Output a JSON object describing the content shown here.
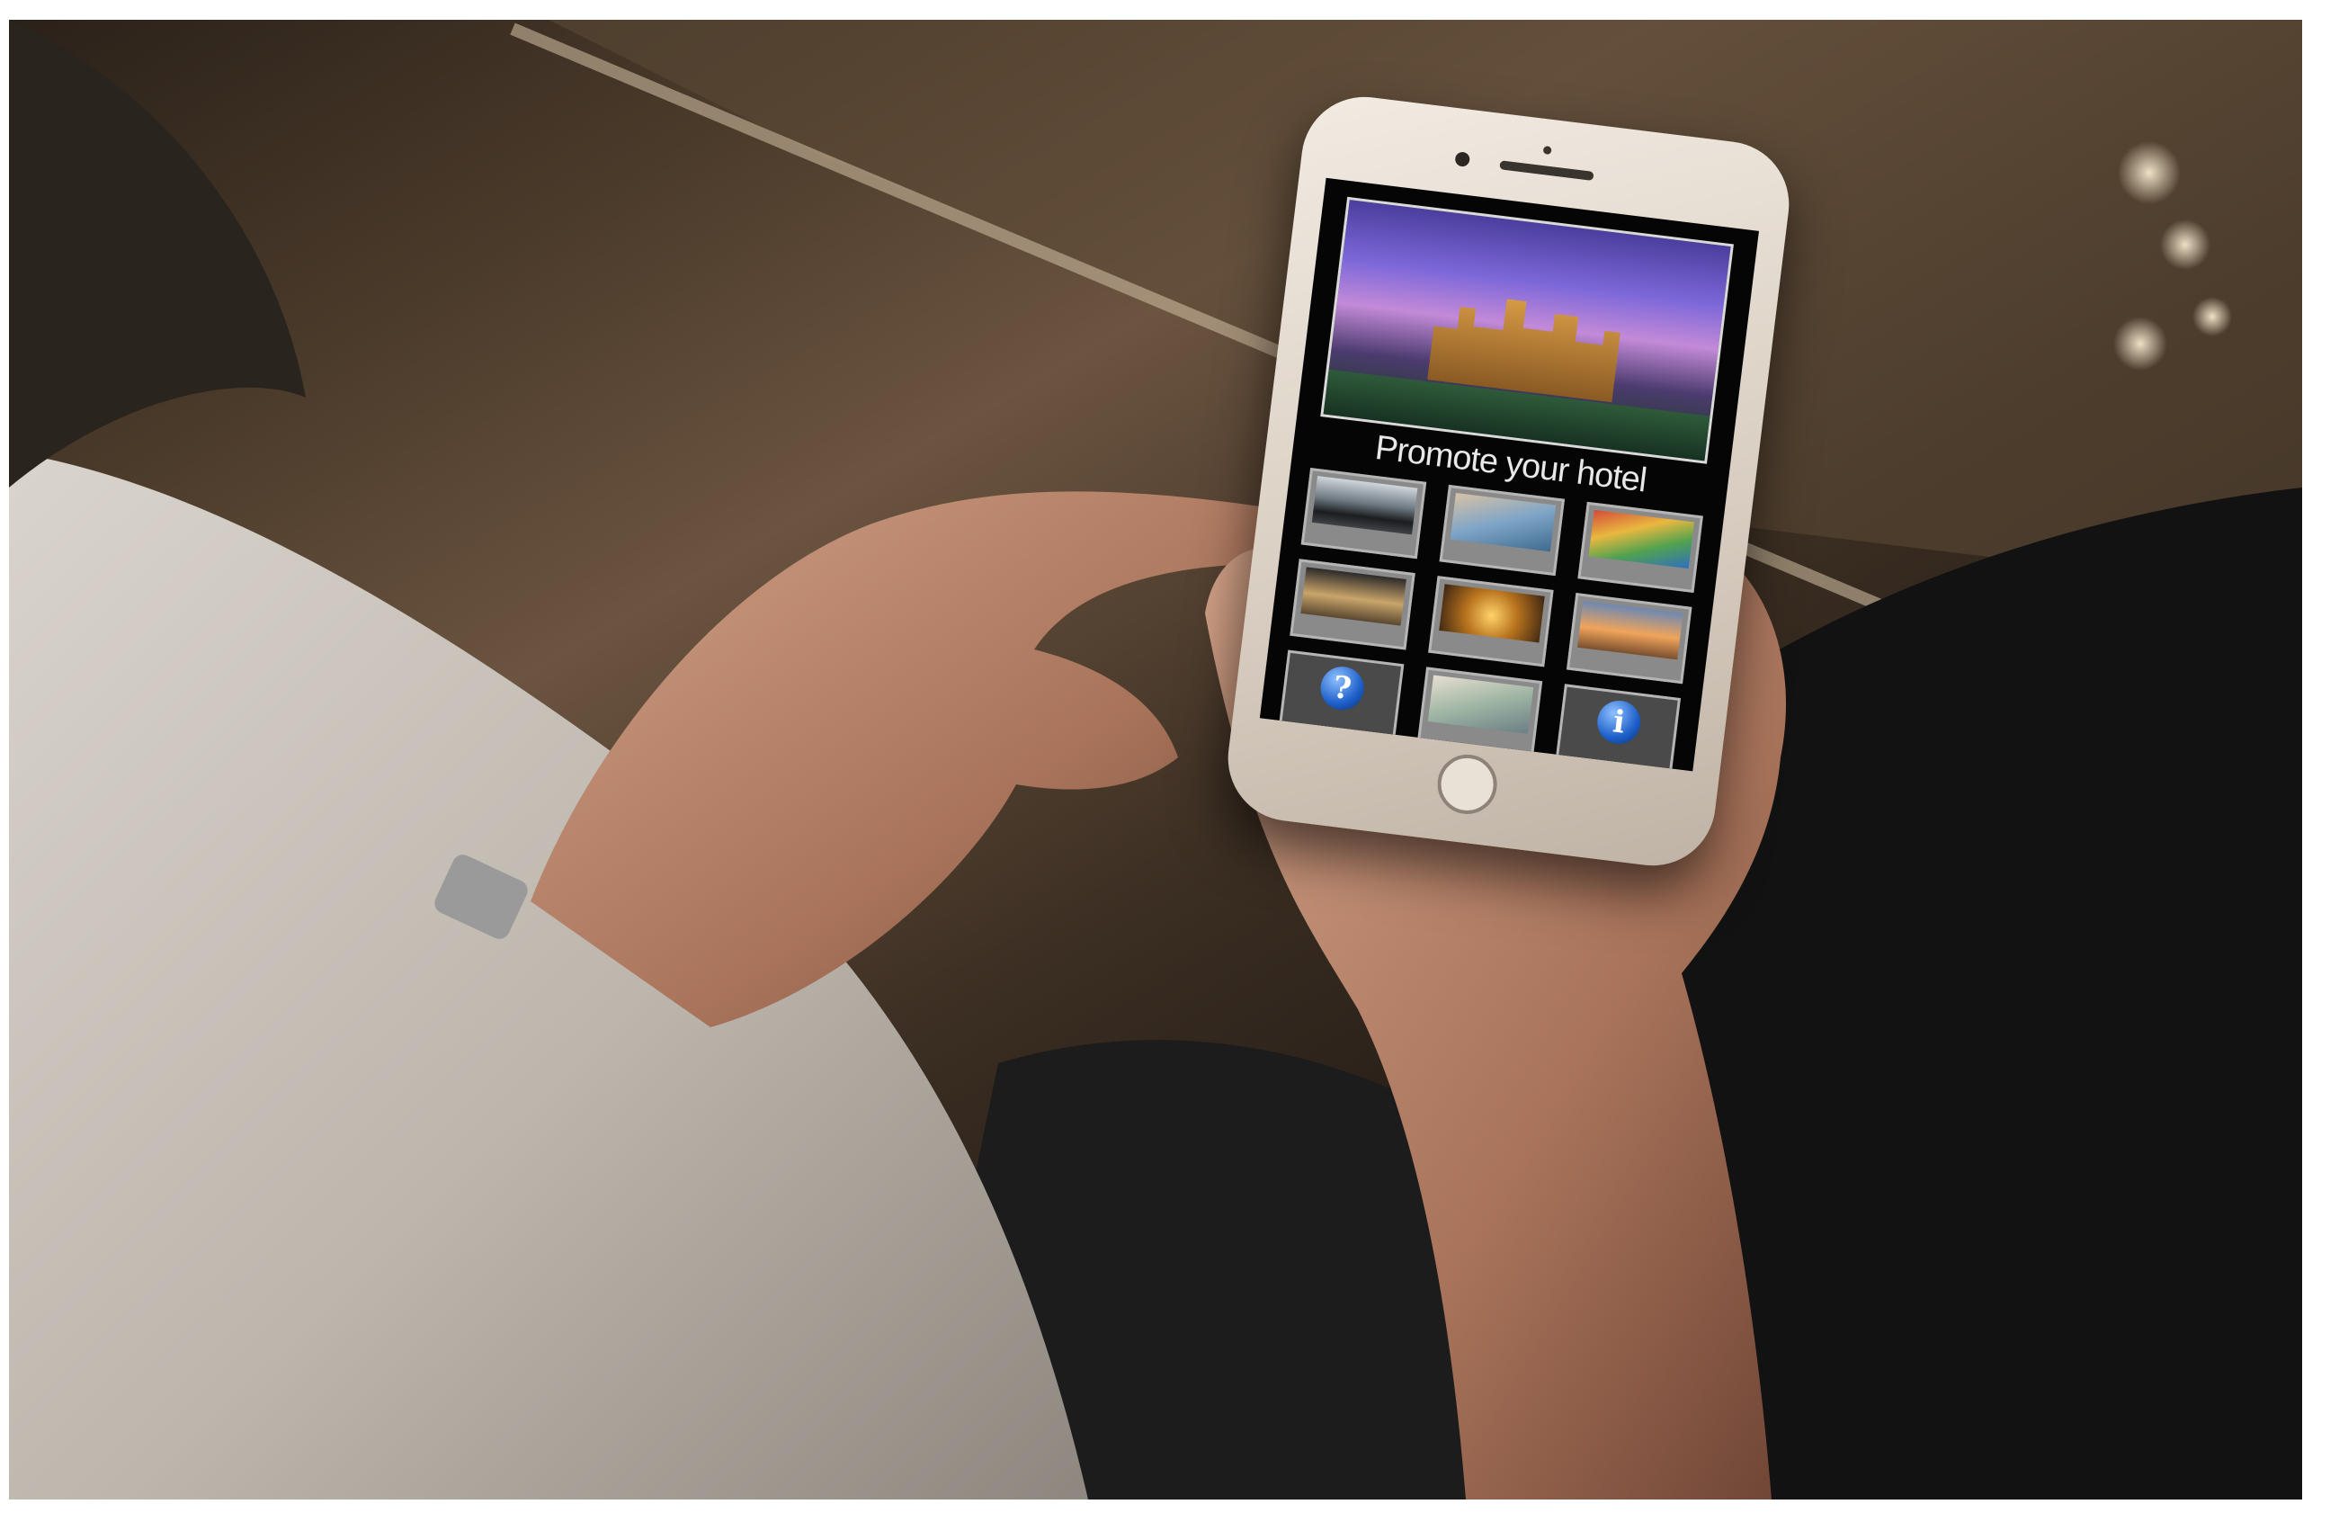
{
  "app": {
    "title": "Promote your hotel",
    "tiles": [
      {
        "label": "",
        "icon": "car-image"
      },
      {
        "label": "",
        "icon": "room-image"
      },
      {
        "label": "",
        "icon": "art-image"
      },
      {
        "label": "",
        "icon": "landscape-image"
      },
      {
        "label": "",
        "icon": "dining-image"
      },
      {
        "label": "",
        "icon": "airplane-image"
      },
      {
        "label": "",
        "icon": "question-icon",
        "glyph": "?"
      },
      {
        "label": "",
        "icon": "spa-image"
      },
      {
        "label": "",
        "icon": "info-icon",
        "glyph": "i"
      }
    ]
  }
}
